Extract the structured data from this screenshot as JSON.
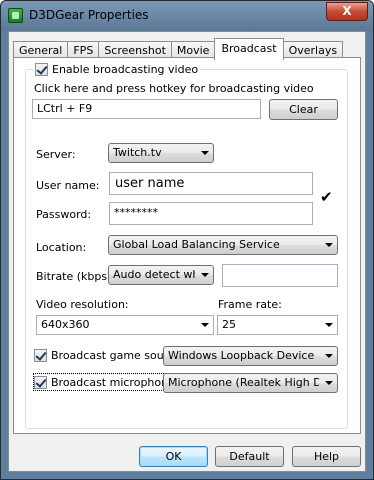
{
  "window": {
    "title": "D3DGear Properties",
    "close_label": "X"
  },
  "tabs": [
    {
      "label": "General"
    },
    {
      "label": "FPS"
    },
    {
      "label": "Screenshot"
    },
    {
      "label": "Movie"
    },
    {
      "label": "Broadcast",
      "active": true
    },
    {
      "label": "Overlays"
    }
  ],
  "broadcast": {
    "enable_label": "Enable broadcasting video",
    "enable_checked": true,
    "hotkey_hint": "Click here and press hotkey for broadcasting video",
    "hotkey_value": "LCtrl + F9",
    "clear_label": "Clear",
    "server_label": "Server:",
    "server_value": "Twitch.tv",
    "username_label": "User name:",
    "username_value": "user name",
    "password_label": "Password:",
    "password_value": "********",
    "check_glyph": "✔",
    "location_label": "Location:",
    "location_value": "Global Load Balancing Service",
    "bitrate_label": "Bitrate (kbps):",
    "bitrate_value": "Audo detect when",
    "bitrate_custom_value": "",
    "video_res_label": "Video resolution:",
    "video_res_value": "640x360",
    "frame_rate_label": "Frame rate:",
    "frame_rate_value": "25",
    "game_sound_label": "Broadcast game sound:",
    "game_sound_checked": true,
    "game_sound_value": "Windows Loopback Device",
    "microphone_label": "Broadcast microphone:",
    "microphone_checked": true,
    "microphone_value": "Microphone (Realtek High Definitio"
  },
  "footer": {
    "ok_label": "OK",
    "default_label": "Default",
    "help_label": "Help"
  }
}
